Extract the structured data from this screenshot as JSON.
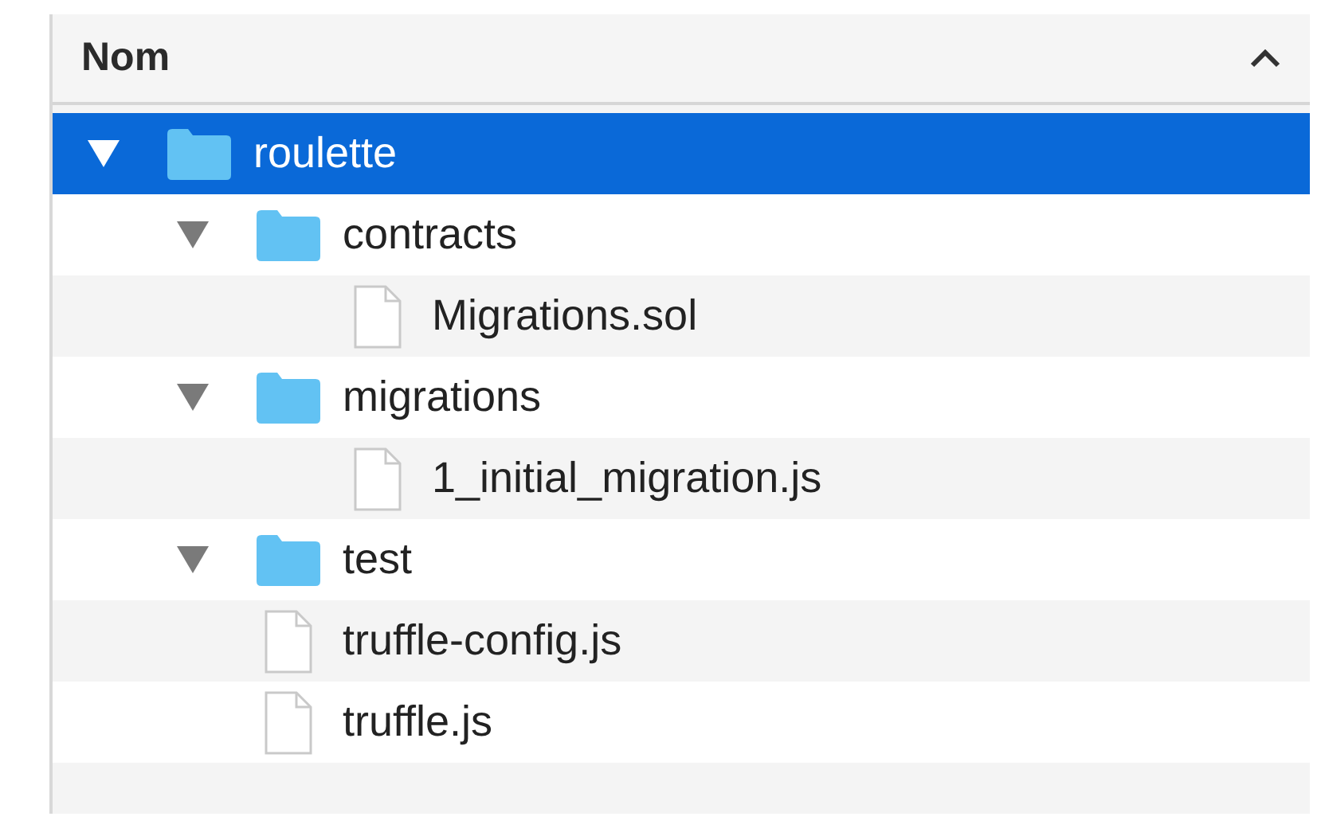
{
  "column_header": {
    "label": "Nom"
  },
  "tree": [
    {
      "name": "roulette",
      "kind": "folder",
      "expanded": true,
      "selected": true,
      "children": [
        {
          "name": "contracts",
          "kind": "folder",
          "expanded": true,
          "selected": false,
          "children": [
            {
              "name": "Migrations.sol",
              "kind": "file",
              "selected": false
            }
          ]
        },
        {
          "name": "migrations",
          "kind": "folder",
          "expanded": true,
          "selected": false,
          "children": [
            {
              "name": "1_initial_migration.js",
              "kind": "file",
              "selected": false
            }
          ]
        },
        {
          "name": "test",
          "kind": "folder",
          "expanded": true,
          "selected": false
        },
        {
          "name": "truffle-config.js",
          "kind": "file",
          "selected": false
        },
        {
          "name": "truffle.js",
          "kind": "file",
          "selected": false
        }
      ]
    }
  ]
}
